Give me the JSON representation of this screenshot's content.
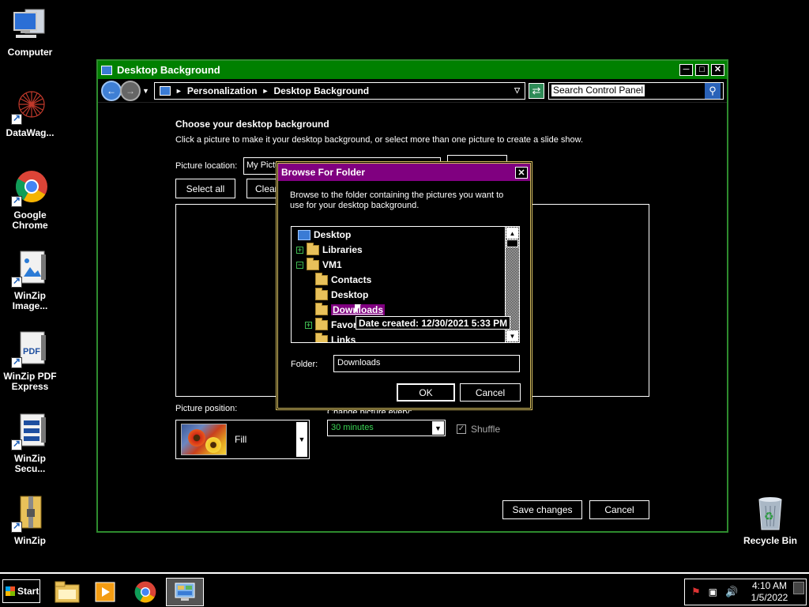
{
  "desktop": {
    "icons": [
      {
        "label": "Computer"
      },
      {
        "label": "DataWag..."
      },
      {
        "label": "Google Chrome"
      },
      {
        "label": "WinZip Image..."
      },
      {
        "label": "WinZip PDF Express"
      },
      {
        "label": "WinZip Secu..."
      },
      {
        "label": "WinZip"
      },
      {
        "label": "Recycle Bin"
      }
    ]
  },
  "window": {
    "title": "Desktop Background",
    "breadcrumb": [
      "Personalization",
      "Desktop Background"
    ],
    "search_value": "Search Control Panel",
    "heading": "Choose your desktop background",
    "description": "Click a picture to make it your desktop background, or select more than one picture to create a slide show.",
    "picture_location_label": "Picture location:",
    "picture_location_value": "My Pictures",
    "select_all_label": "Select all",
    "clear_all_label": "Clear all",
    "picture_position_label": "Picture position:",
    "picture_position_value": "Fill",
    "change_picture_label": "Change picture every:",
    "interval_value": "30 minutes",
    "shuffle_label": "Shuffle",
    "shuffle_checked": true,
    "save_label": "Save changes",
    "cancel_label": "Cancel"
  },
  "dialog": {
    "title": "Browse For Folder",
    "description": "Browse to the folder containing the pictures you want to use for your desktop background.",
    "tree": [
      {
        "label": "Desktop",
        "icon": "monitor-icon",
        "expander": ""
      },
      {
        "label": "Libraries",
        "icon": "libraries-icon",
        "expander": "+"
      },
      {
        "label": "VM1",
        "icon": "user-folder-icon",
        "expander": "−"
      },
      {
        "label": "Contacts",
        "icon": "folder-icon",
        "expander": ""
      },
      {
        "label": "Desktop",
        "icon": "folder-icon",
        "expander": ""
      },
      {
        "label": "Downloads",
        "icon": "folder-icon",
        "expander": "",
        "selected": true
      },
      {
        "label": "Favorites",
        "icon": "folder-icon",
        "expander": "+"
      },
      {
        "label": "Links",
        "icon": "folder-icon",
        "expander": ""
      }
    ],
    "tooltip": "Date created: 12/30/2021 5:33 PM",
    "folder_label": "Folder:",
    "folder_value": "Downloads",
    "ok_label": "OK",
    "cancel_label": "Cancel"
  },
  "taskbar": {
    "start_label": "Start",
    "time": "4:10 AM",
    "date": "1/5/2022",
    "pinned": [
      "file-explorer-icon",
      "media-player-icon",
      "chrome-icon",
      "control-panel-icon"
    ]
  },
  "colors": {
    "window_title": "#008000",
    "dialog_title": "#800080",
    "selection": "#800080",
    "interval_text": "#39d353"
  }
}
